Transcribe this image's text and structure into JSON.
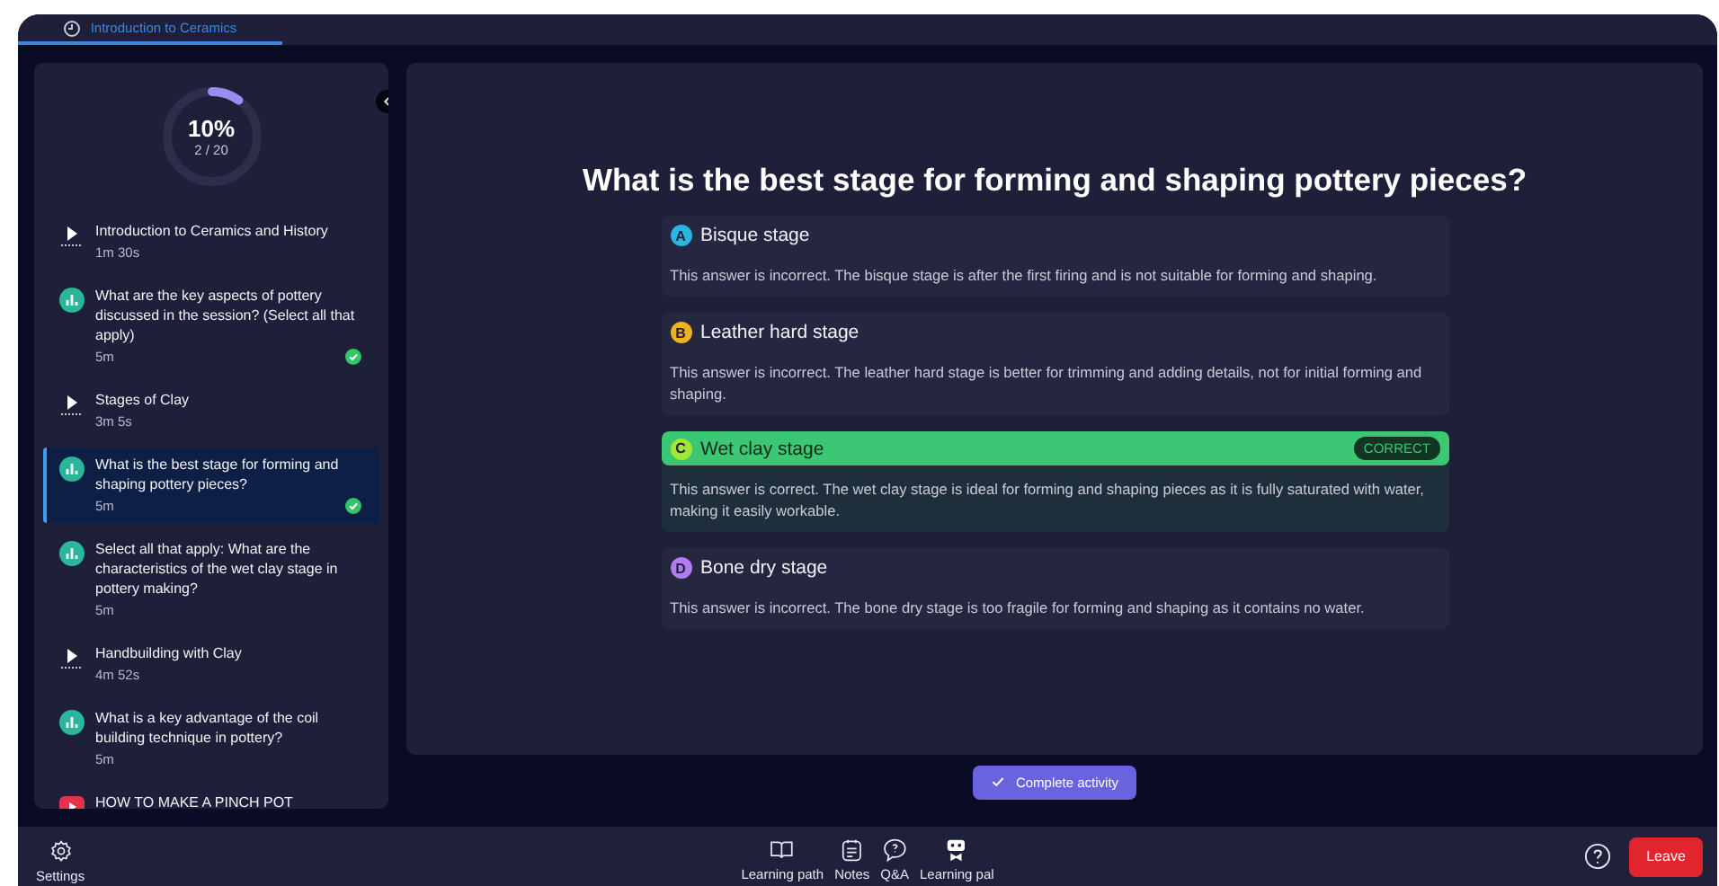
{
  "tab": {
    "label": "Introduction to Ceramics",
    "selected": true
  },
  "progress": {
    "percent": "10%",
    "count": "2 / 20",
    "level": 0.1
  },
  "items": [
    {
      "kind": "video",
      "title": "Introduction to Ceramics and History",
      "duration": "1m 30s",
      "completed": false,
      "selected": false
    },
    {
      "kind": "quiz",
      "title": "What are the key aspects of pottery discussed in the session? (Select all that apply)",
      "duration": "5m",
      "completed": true,
      "selected": false
    },
    {
      "kind": "video",
      "title": "Stages of Clay",
      "duration": "3m 5s",
      "completed": false,
      "selected": false
    },
    {
      "kind": "quiz",
      "title": "What is the best stage for forming and shaping pottery pieces?",
      "duration": "5m",
      "completed": true,
      "selected": true
    },
    {
      "kind": "quiz",
      "title": "Select all that apply: What are the characteristics of the wet clay stage in pottery making?",
      "duration": "5m",
      "completed": false,
      "selected": false
    },
    {
      "kind": "video",
      "title": "Handbuilding with Clay",
      "duration": "4m 52s",
      "completed": false,
      "selected": false
    },
    {
      "kind": "quiz",
      "title": "What is a key advantage of the coil building technique in pottery?",
      "duration": "5m",
      "completed": false,
      "selected": false
    },
    {
      "kind": "youtube",
      "title": "HOW TO MAKE A PINCH POT",
      "completed": false,
      "selected": false
    }
  ],
  "question": "What is the best stage for forming and shaping pottery pieces?",
  "answers": [
    {
      "letter": "A",
      "color": "#29b6e0",
      "label": "Bisque stage",
      "explanation": "This answer is incorrect. The bisque stage is after the first firing and is not suitable for forming and shaping.",
      "correct": false
    },
    {
      "letter": "B",
      "color": "#f0b21c",
      "label": "Leather hard stage",
      "explanation": "This answer is incorrect. The leather hard stage is better for trimming and adding details, not for initial forming and shaping.",
      "correct": false
    },
    {
      "letter": "C",
      "color": "#a3e635",
      "label": "Wet clay stage",
      "explanation": "This answer is correct. The wet clay stage is ideal for forming and shaping pieces as it is fully saturated with water, making it easily workable.",
      "correct": true,
      "badge": "CORRECT"
    },
    {
      "letter": "D",
      "color": "#b07cf0",
      "label": "Bone dry stage",
      "explanation": "This answer is incorrect. The bone dry stage is too fragile for forming and shaping as it contains no water.",
      "correct": false
    }
  ],
  "complete_button": "Complete activity",
  "settings": "Settings",
  "nav": [
    {
      "kind": "book",
      "label": "Learning path"
    },
    {
      "kind": "notes",
      "label": "Notes"
    },
    {
      "kind": "qa",
      "label": "Q&A"
    },
    {
      "kind": "robot",
      "label": "Learning pal"
    }
  ],
  "leave_button": "Leave"
}
